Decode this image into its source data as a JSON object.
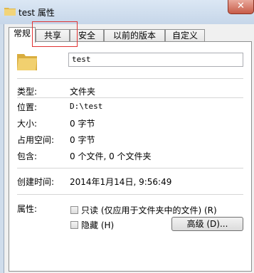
{
  "window": {
    "title": "test 属性",
    "close_symbol": "✕"
  },
  "tabs": [
    {
      "label": "常规",
      "active": true
    },
    {
      "label": "共享",
      "active": false
    },
    {
      "label": "安全",
      "active": false
    },
    {
      "label": "以前的版本",
      "active": false
    },
    {
      "label": "自定义",
      "active": false
    }
  ],
  "general": {
    "name_value": "test",
    "type_label": "类型:",
    "type_value": "文件夹",
    "location_label": "位置:",
    "location_value": "D:\\test",
    "size_label": "大小:",
    "size_value": "0 字节",
    "size_on_disk_label": "占用空间:",
    "size_on_disk_value": "0 字节",
    "contains_label": "包含:",
    "contains_value": "0 个文件, 0 个文件夹",
    "created_label": "创建时间:",
    "created_value": "2014年1月14日, 9:56:49",
    "attributes_label": "属性:",
    "readonly_label": "只读 (仅应用于文件夹中的文件) (R)",
    "hidden_label": "隐藏 (H)",
    "advanced_button": "高级 (D)..."
  },
  "colors": {
    "highlight": "#e03232",
    "folder": "#e8c25a"
  }
}
